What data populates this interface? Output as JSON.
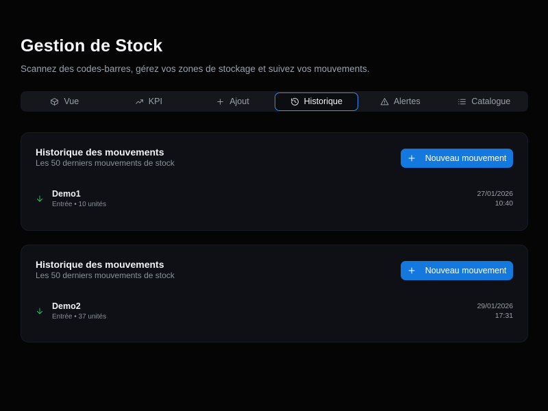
{
  "header": {
    "title": "Gestion de Stock",
    "subtitle": "Scannez des codes-barres, gérez vos zones de stockage et suivez vos mouvements."
  },
  "tabs": [
    {
      "label": "Vue",
      "icon": "box-icon",
      "active": false
    },
    {
      "label": "KPI",
      "icon": "trending-up-icon",
      "active": false
    },
    {
      "label": "Ajout",
      "icon": "plus-icon",
      "active": false
    },
    {
      "label": "Historique",
      "icon": "history-icon",
      "active": true
    },
    {
      "label": "Alertes",
      "icon": "alert-triangle-icon",
      "active": false
    },
    {
      "label": "Catalogue",
      "icon": "list-icon",
      "active": false
    }
  ],
  "cards": [
    {
      "title": "Historique des mouvements",
      "subtitle": "Les 50 derniers mouvements de stock",
      "button_label": "Nouveau mouvement",
      "movement": {
        "name": "Demo1",
        "detail": "Entrée • 10 unités",
        "date": "27/01/2026",
        "time": "10:40"
      }
    },
    {
      "title": "Historique des mouvements",
      "subtitle": "Les 50 derniers mouvements de stock",
      "button_label": "Nouveau mouvement",
      "movement": {
        "name": "Demo2",
        "detail": "Entrée • 37 unités",
        "date": "29/01/2026",
        "time": "17:31"
      }
    }
  ],
  "colors": {
    "accent": "#1479df",
    "active_tab_border": "#2f8cf0",
    "entry_arrow": "#2ecc71",
    "background": "#050506",
    "card": "#0e1015"
  }
}
